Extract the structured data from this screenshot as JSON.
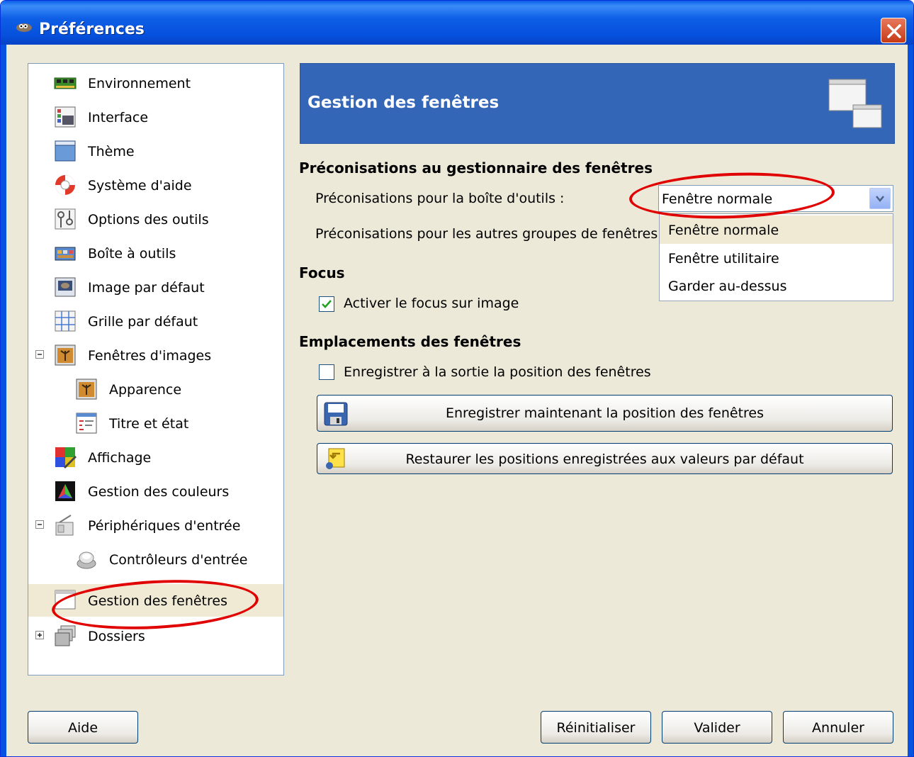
{
  "window": {
    "title": "Préférences"
  },
  "colors": {
    "titlebar": "#0550dc",
    "banner": "#3466b8",
    "selection": "#f0ead5",
    "annotation": "#e00000"
  },
  "tree": {
    "items": [
      {
        "label": "Environnement",
        "icon": "memory-icon"
      },
      {
        "label": "Interface",
        "icon": "interface-icon"
      },
      {
        "label": "Thème",
        "icon": "theme-icon"
      },
      {
        "label": "Système d'aide",
        "icon": "lifebuoy-icon"
      },
      {
        "label": "Options des outils",
        "icon": "tool-options-icon"
      },
      {
        "label": "Boîte à outils",
        "icon": "toolbox-icon"
      },
      {
        "label": "Image par défaut",
        "icon": "default-image-icon"
      },
      {
        "label": "Grille par défaut",
        "icon": "grid-icon"
      },
      {
        "label": "Fenêtres d'images",
        "icon": "image-window-icon",
        "expander": "minus"
      },
      {
        "label": "Apparence",
        "icon": "appearance-icon"
      },
      {
        "label": "Titre et état",
        "icon": "title-status-icon"
      },
      {
        "label": "Affichage",
        "icon": "display-icon"
      },
      {
        "label": "Gestion des couleurs",
        "icon": "color-management-icon"
      },
      {
        "label": "Périphériques d'entrée",
        "icon": "input-devices-icon",
        "expander": "minus"
      },
      {
        "label": "Contrôleurs d'entrée",
        "icon": "controllers-icon"
      },
      {
        "label": "Gestion des fenêtres",
        "icon": "window-management-icon",
        "selected": true
      },
      {
        "label": "Dossiers",
        "icon": "folders-icon",
        "expander": "plus"
      }
    ]
  },
  "page": {
    "title": "Gestion des fenêtres",
    "hints_section": "Préconisations au gestionnaire des fenêtres",
    "toolbox_hint_label": "Préconisations pour la boîte d'outils :",
    "toolbox_hint_value": "Fenêtre normale",
    "dock_hint_label": "Préconisations pour les autres groupes de fenêtres :",
    "dropdown_options": [
      "Fenêtre normale",
      "Fenêtre utilitaire",
      "Garder au-dessus"
    ],
    "focus_section": "Focus",
    "focus_checkbox": {
      "label": "Activer le focus sur image",
      "checked": true
    },
    "positions_section": "Emplacements des fenêtres",
    "save_on_exit_checkbox": {
      "label": "Enregistrer à la sortie la position des fenêtres",
      "checked": false
    },
    "save_now_button": "Enregistrer maintenant la position des fenêtres",
    "reset_button": "Restaurer les positions enregistrées aux valeurs par défaut"
  },
  "footer": {
    "help": "Aide",
    "reset": "Réinitialiser",
    "ok": "Valider",
    "cancel": "Annuler"
  }
}
